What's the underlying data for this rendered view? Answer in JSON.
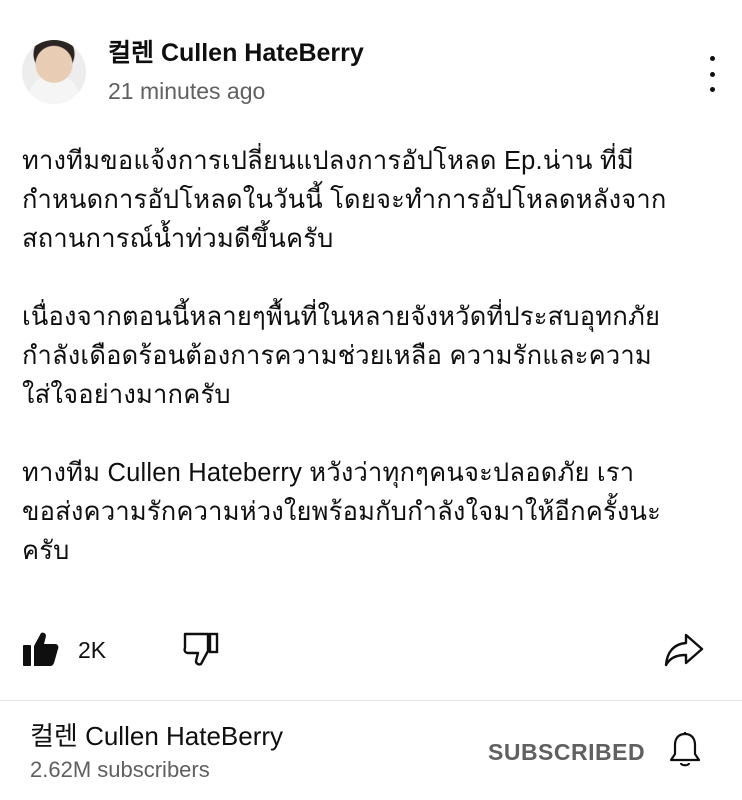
{
  "post": {
    "channel_name": "컬렌 Cullen HateBerry",
    "timestamp": "21 minutes ago",
    "paragraphs": [
      "ทางทีมขอแจ้งการเปลี่ยนแปลงการอัปโหลด Ep.น่าน ที่มี\nกำหนดการอัปโหลดในวันนี้ โดยจะทำการอัปโหลดหลังจาก\nสถานการณ์น้ำท่วมดีขึ้นครับ",
      "เนื่องจากตอนนี้หลายๆพื้นที่ในหลายจังหวัดที่ประสบอุทกภัย\nกำลังเดือดร้อนต้องการความช่วยเหลือ ความรักและความ\nใส่ใจอย่างมากครับ",
      "ทางทีม Cullen Hateberry หวังว่าทุกๆคนจะปลอดภัย เรา\nขอส่งความรักความห่วงใยพร้อมกับกำลังใจมาให้อีกครั้งนะ\nครับ"
    ],
    "like_count": "2K",
    "icons": {
      "avatar": "channel-avatar",
      "more": "more-vertical-icon",
      "like": "thumbs-up-filled-icon",
      "dislike": "thumbs-down-outline-icon",
      "share": "share-arrow-icon"
    }
  },
  "footer": {
    "channel_name": "컬렌 Cullen HateBerry",
    "subscribers": "2.62M subscribers",
    "subscribe_label": "SUBSCRIBED",
    "icons": {
      "bell": "notification-bell-icon"
    }
  },
  "colors": {
    "text_primary": "#0f0f0f",
    "text_secondary": "#606060",
    "divider": "#e5e5e5",
    "background": "#ffffff"
  }
}
